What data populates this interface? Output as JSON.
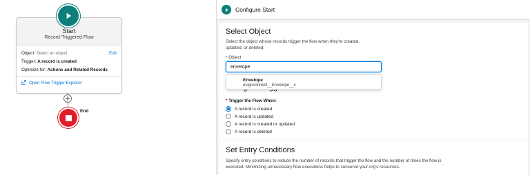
{
  "flow": {
    "start_title": "Start",
    "start_subtitle": "Record-Triggered Flow",
    "object_key": "Object:",
    "object_value": "Select an object",
    "edit_label": "Edit",
    "trigger_key": "Trigger:",
    "trigger_value": "A record is created",
    "optimize_key": "Optimize for:",
    "optimize_value": "Actions and Related Records",
    "explorer_link": "Open Flow Trigger Explorer",
    "end_label": "End"
  },
  "panel": {
    "title": "Configure Start",
    "select_object": {
      "title": "Select Object",
      "description_line1": "Select the object whose records trigger the flow when they're created,",
      "description_line2": "updated, or deleted.",
      "required_mark": "*",
      "field_label": "Object",
      "input_value": "envelope",
      "dropdown_option_title": "Envelope",
      "dropdown_option_api": "esignconnect__Envelope__c"
    },
    "configure_trigger": {
      "title": "Configure Trigger",
      "required_mark": "*",
      "label": "Trigger the Flow When:",
      "options": [
        {
          "label": "A record is created",
          "selected": true
        },
        {
          "label": "A record is updated",
          "selected": false
        },
        {
          "label": "A record is created or updated",
          "selected": false
        },
        {
          "label": "A record is deleted",
          "selected": false
        }
      ]
    },
    "entry_conditions": {
      "title": "Set Entry Conditions",
      "description_line1": "Specify entry conditions to reduce the number of records that trigger the flow and the number of times the flow is",
      "description_line2": "executed. Minimizing unnecessary flow executions helps to conserve your org's resources."
    }
  },
  "colors": {
    "start_teal": "#0b7f7a",
    "end_red": "#e01e28",
    "link_blue": "#0176d3"
  }
}
